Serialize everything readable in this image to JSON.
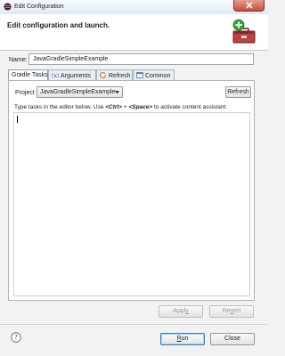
{
  "window": {
    "title": "Edit Configuration",
    "header_title": "Edit configuration and launch."
  },
  "name_field": {
    "label": "Name:",
    "value": "JavaGradleSimpleExample"
  },
  "tabs": [
    {
      "label": "Gradle Tasks",
      "icon": "gradle-icon",
      "active": true
    },
    {
      "label": "Arguments",
      "icon": "arguments-icon",
      "active": false
    },
    {
      "label": "Refresh",
      "icon": "refresh-icon",
      "active": false
    },
    {
      "label": "Common",
      "icon": "common-icon",
      "active": false
    }
  ],
  "gradle_tasks": {
    "project_label": "Project",
    "project_value": "JavaGradleSimpleExample",
    "refresh_label": "Refresh",
    "hint_before": "Type tasks in the editor below. Use ",
    "hint_key1": "<Ctrl>",
    "hint_plus": " + ",
    "hint_key2": "<Space>",
    "hint_after": " to activate content assistant."
  },
  "buttons": {
    "apply_prefix": "Appl",
    "apply_mnemonic": "y",
    "revert_prefix": "Re",
    "revert_mnemonic": "v",
    "revert_suffix": "ert",
    "run_mnemonic": "R",
    "run_suffix": "un",
    "close_label": "Close"
  }
}
